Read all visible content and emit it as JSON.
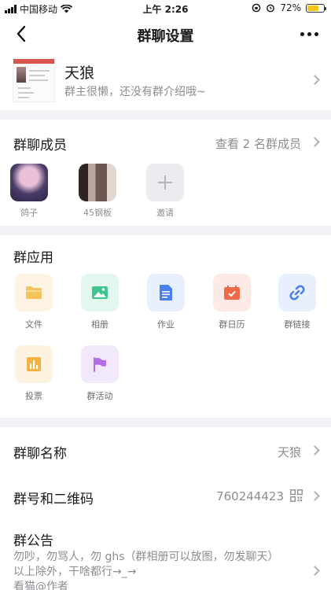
{
  "status_bar": {
    "carrier": "中国移动",
    "time": "上午 2:26",
    "battery_text": "72%",
    "battery_level": 0.72,
    "signal_icon": "signal-bars-icon",
    "wifi_icon": "wifi-icon"
  },
  "nav": {
    "title": "群聊设置",
    "back_icon": "chevron-left-icon",
    "more_icon": "more-dots-icon"
  },
  "group": {
    "name": "天狼",
    "description": "群主很懒，还没有群介绍哦~"
  },
  "members": {
    "title": "群聊成员",
    "view_all": "查看 2 名群成员",
    "items": [
      {
        "name": "鸽子"
      },
      {
        "name": "45钢板"
      },
      {
        "name": "邀请"
      }
    ]
  },
  "apps": {
    "title": "群应用",
    "items": [
      {
        "label": "文件",
        "icon": "folder-icon",
        "color": "#f4c35a",
        "bg": "#fdf3e2"
      },
      {
        "label": "相册",
        "icon": "image-icon",
        "color": "#3dc58c",
        "bg": "#e3f7ee"
      },
      {
        "label": "作业",
        "icon": "document-icon",
        "color": "#4a7ff0",
        "bg": "#e8f0fd"
      },
      {
        "label": "群日历",
        "icon": "calendar-icon",
        "color": "#f06a4a",
        "bg": "#fdeae6"
      },
      {
        "label": "群链接",
        "icon": "link-icon",
        "color": "#4a7ff0",
        "bg": "#e8f0fd"
      },
      {
        "label": "投票",
        "icon": "chart-icon",
        "color": "#f4b240",
        "bg": "#fdf1e0"
      },
      {
        "label": "群活动",
        "icon": "flag-icon",
        "color": "#b26ee8",
        "bg": "#f1e8fb"
      }
    ]
  },
  "settings": {
    "group_name_label": "群聊名称",
    "group_name_value": "天狼",
    "group_number_label": "群号和二维码",
    "group_number_value": "760244423",
    "announcement_label": "群公告",
    "announcement_lines": [
      "勿吵，勿骂人，勿 ghs（群相册可以放图，勿发聊天）",
      "以上除外，干啥都行→_→",
      "看猫@作者"
    ]
  }
}
